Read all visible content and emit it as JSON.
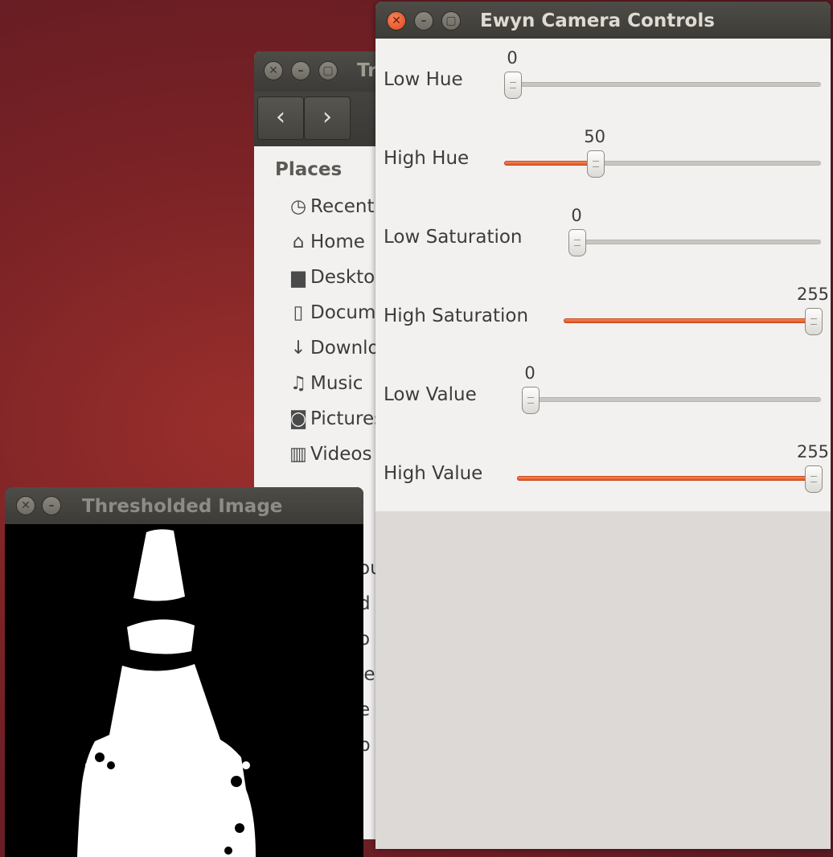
{
  "file_manager": {
    "title": "Tr",
    "back_icon": "chevron-left-icon",
    "forward_icon": "chevron-right-icon",
    "places_label": "Places",
    "places": [
      {
        "label": "Recent",
        "icon": "clock-icon"
      },
      {
        "label": "Home",
        "icon": "home-icon"
      },
      {
        "label": "Desktop",
        "icon": "folder-icon"
      },
      {
        "label": "Documents",
        "icon": "document-icon"
      },
      {
        "label": "Downloads",
        "icon": "download-icon"
      },
      {
        "label": "Music",
        "icon": "music-icon"
      },
      {
        "label": "Pictures",
        "icon": "camera-icon"
      },
      {
        "label": "Videos",
        "icon": "film-icon"
      }
    ],
    "hidden_fragments": [
      "ou",
      "d",
      "o",
      "le",
      "e",
      "b"
    ]
  },
  "threshold_window": {
    "title": "Thresholded Image"
  },
  "controls_window": {
    "title": "Ewyn Camera Controls",
    "accent_color": "#e95420",
    "sliders": [
      {
        "label": "Low Hue",
        "value": "0",
        "fraction": 0
      },
      {
        "label": "High Hue",
        "value": "50",
        "fraction": 0.2745
      },
      {
        "label": "Low Saturation",
        "value": "0",
        "fraction": 0
      },
      {
        "label": "High Saturation",
        "value": "255",
        "fraction": 1
      },
      {
        "label": "Low Value",
        "value": "0",
        "fraction": 0
      },
      {
        "label": "High Value",
        "value": "255",
        "fraction": 1
      }
    ]
  }
}
